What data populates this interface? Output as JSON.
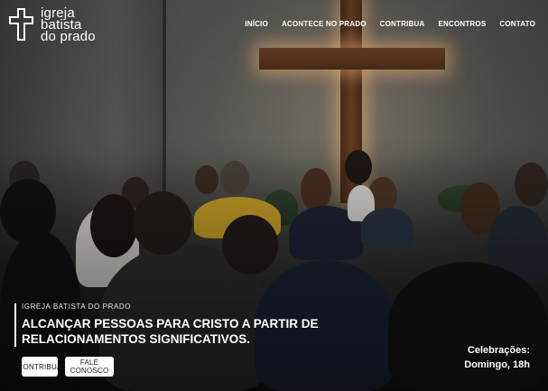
{
  "brand": {
    "logo_lines": [
      "igreja",
      "batista",
      "do prado"
    ],
    "logo_icon": "cross-icon"
  },
  "nav": {
    "items": [
      {
        "label": "INÍCIO"
      },
      {
        "label": "ACONTECE NO PRADO"
      },
      {
        "label": "CONTRIBUA"
      },
      {
        "label": "ENCONTROS"
      },
      {
        "label": "CONTATO"
      }
    ]
  },
  "hero": {
    "eyebrow": "IGREJA BATISTA DO PRADO",
    "headline_line1": "ALCANÇAR PESSOAS PARA CRISTO A PARTIR DE",
    "headline_line2": "RELACIONAMENTOS SIGNIFICATIVOS.",
    "buttons": {
      "contribua": "CONTRIBUA",
      "fale_conosco": "FALE CONOSCO"
    },
    "schedule": {
      "title": "Celebrações:",
      "time": "Domingo, 18h"
    }
  },
  "colors": {
    "accent_white": "#ffffff",
    "cross_wood": "#6b3f22",
    "cross_glow": "#ffbe78"
  }
}
